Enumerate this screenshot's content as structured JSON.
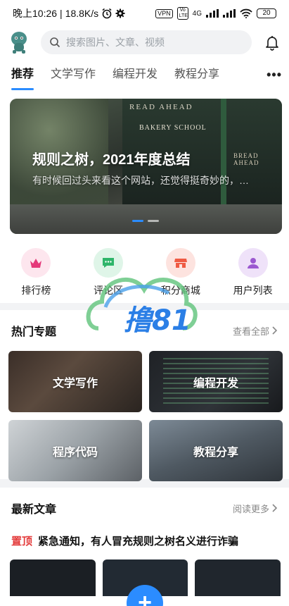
{
  "status_bar": {
    "time": "晚上10:26",
    "speed": "18.8K/s",
    "vpn": "VPN",
    "volte": "Vo LTE",
    "network": "4G",
    "battery": "20"
  },
  "header": {
    "search_placeholder": "搜索图片、文章、视频",
    "icons": [
      "avatar-logo",
      "search-icon",
      "bell-icon"
    ]
  },
  "tabs": {
    "items": [
      "推荐",
      "文学写作",
      "编程开发",
      "教程分享"
    ],
    "active_index": 0,
    "more": "•••"
  },
  "banner": {
    "title": "规则之树，2021年度总结",
    "subtitle": "有时候回过头来看这个网站，还觉得挺奇妙的，…",
    "sign_top": "READ AHEAD",
    "sign_bakery": "BAKERY SCHOOL",
    "sign_right": "BREAD AHEAD",
    "slide_count": 2,
    "active_slide": 0
  },
  "quick_links": [
    {
      "label": "排行榜",
      "icon": "crown-icon",
      "color": "#e5397a",
      "bg": "#fde6ee"
    },
    {
      "label": "评论区",
      "icon": "comment-icon",
      "color": "#2fb56a",
      "bg": "#dff5e8"
    },
    {
      "label": "积分商城",
      "icon": "store-icon",
      "color": "#ef5a43",
      "bg": "#fde3df"
    },
    {
      "label": "用户列表",
      "icon": "user-icon",
      "color": "#9b59d0",
      "bg": "#efe2f9"
    }
  ],
  "watermark": {
    "text": "撸81"
  },
  "hot_topics": {
    "title": "热门专题",
    "more": "查看全部",
    "items": [
      "文学写作",
      "编程开发",
      "程序代码",
      "教程分享"
    ]
  },
  "latest": {
    "title": "最新文章",
    "more": "阅读更多",
    "pinned_tag": "置顶",
    "pinned_title": "紧急通知，有人冒充规则之树名义进行诈骗"
  },
  "bottom_nav": {
    "fab_label": "+"
  }
}
